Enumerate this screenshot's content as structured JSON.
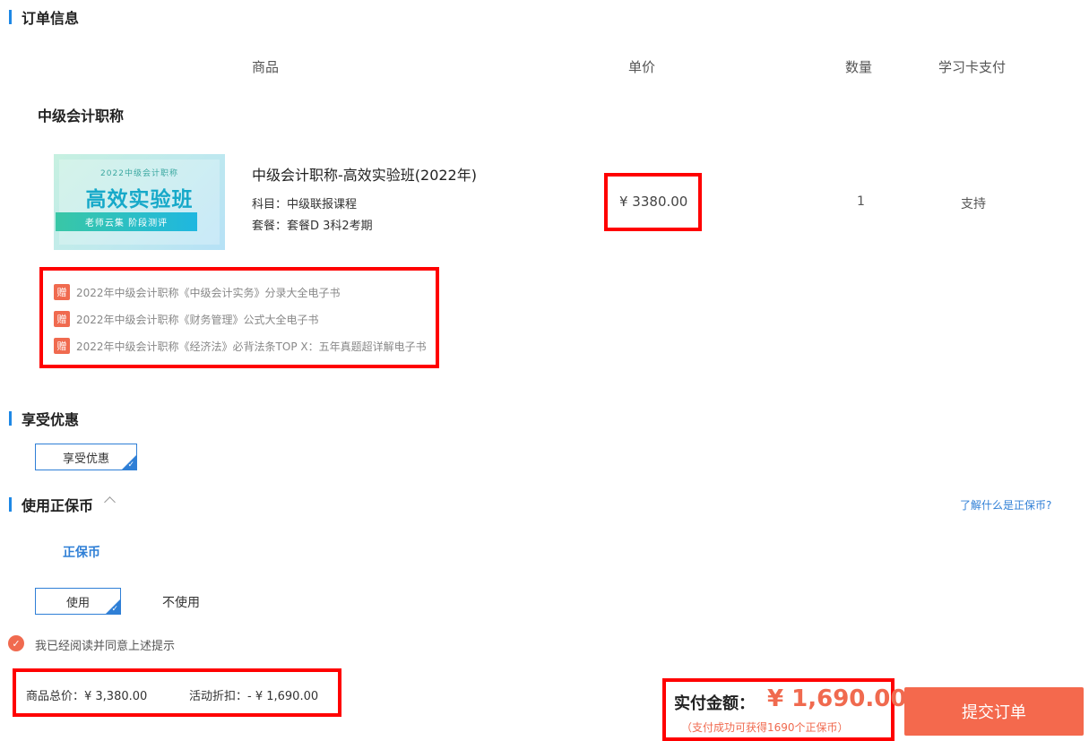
{
  "sections": {
    "order_info": "订单信息",
    "discounts": "享受优惠",
    "coins": "使用正保币"
  },
  "columns": {
    "product": "商品",
    "unit_price": "单价",
    "quantity": "数量",
    "card_pay": "学习卡支付"
  },
  "group_name": "中级会计职称",
  "product": {
    "thumb_small": "2022中级会计职称",
    "thumb_big": "高效实验班",
    "thumb_strip": "老师云集 阶段测评",
    "title": "中级会计职称-高效实验班(2022年)",
    "subject": "科目：中级联报课程",
    "package": "套餐：套餐D 3科2考期",
    "price": "¥ 3380.00",
    "quantity": "1",
    "card_support": "支持"
  },
  "gifts": {
    "badge": "赠",
    "items": [
      "2022年中级会计职称《中级会计实务》分录大全电子书",
      "2022年中级会计职称《财务管理》公式大全电子书",
      "2022年中级会计职称《经济法》必背法条TOP X：五年真题超详解电子书"
    ]
  },
  "discount_option": "享受优惠",
  "coins": {
    "learn_link": "了解什么是正保币?",
    "label": "正保币",
    "use": "使用",
    "no_use": "不使用"
  },
  "agreement": {
    "icon": "✓",
    "text": "我已经阅读并同意上述提示"
  },
  "summary": {
    "total": "商品总价：¥ 3,380.00",
    "discount": "活动折扣：- ¥ 1,690.00"
  },
  "payment": {
    "label": "实付金额：",
    "amount": "¥ 1,690.00",
    "note": "（支付成功可获得1690个正保币）",
    "submit": "提交订单"
  },
  "colors": {
    "accent_blue": "#2f7fd6",
    "accent_orange": "#f06a4f",
    "highlight_red": "#ff0000"
  }
}
